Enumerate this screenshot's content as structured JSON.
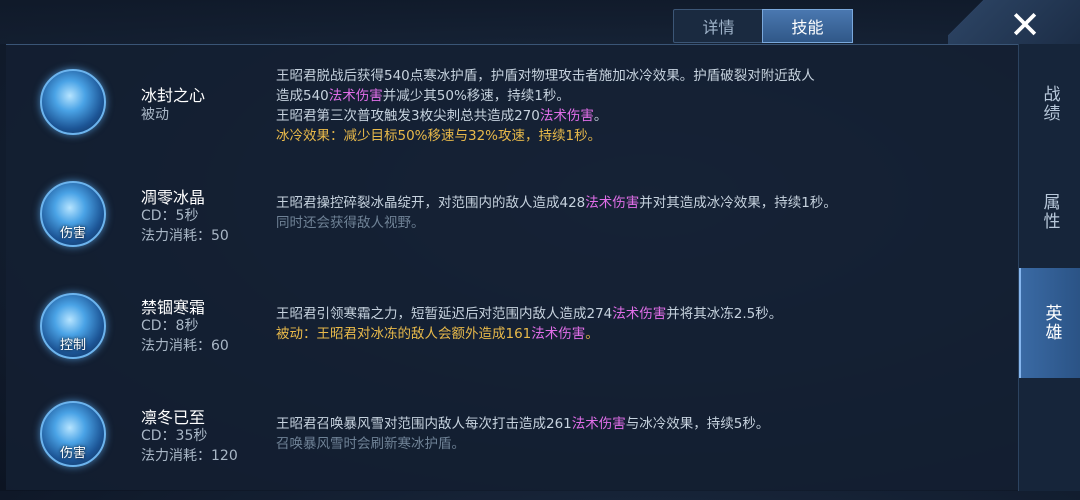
{
  "tabs": {
    "details": "详情",
    "skills": "技能"
  },
  "side_tabs": {
    "record": "战绩",
    "attributes": "属性",
    "hero": "英雄"
  },
  "close_symbol": "✕",
  "skills": [
    {
      "name": "冰封之心",
      "line1": "被动",
      "line2": "",
      "icon_tag": "",
      "desc1a": "王昭君脱战后获得540点寒冰护盾，护盾对物理攻击者施加冰冷效果。护盾破裂对附近敌人",
      "desc2a": "造成540",
      "desc2hl": "法术伤害",
      "desc2b": "并减少其50%移速，持续1秒。",
      "desc3a": "王昭君第三次普攻触发3枚尖刺总共造成270",
      "desc3hl": "法术伤害",
      "desc3b": "。",
      "desc4": "冰冷效果：减少目标50%移速与32%攻速，持续1秒。"
    },
    {
      "name": "凋零冰晶",
      "line1": "CD：5秒",
      "line2": "法力消耗：50",
      "icon_tag": "伤害",
      "desc1a": "王昭君操控碎裂冰晶绽开，对范围内的敌人造成428",
      "desc1hl": "法术伤害",
      "desc1b": "并对其造成冰冷效果，持续1秒。",
      "desc2": "同时还会获得敌人视野。"
    },
    {
      "name": "禁锢寒霜",
      "line1": "CD：8秒",
      "line2": "法力消耗：60",
      "icon_tag": "控制",
      "desc1a": "王昭君引领寒霜之力，短暂延迟后对范围内敌人造成274",
      "desc1hl": "法术伤害",
      "desc1b": "并将其冰冻2.5秒。",
      "desc2a": "被动：王昭君对冰冻的敌人会额外造成161",
      "desc2hl": "法术伤害",
      "desc2b": "。"
    },
    {
      "name": "凛冬已至",
      "line1": "CD：35秒",
      "line2": "法力消耗：120",
      "icon_tag": "伤害",
      "desc1a": "王昭君召唤暴风雪对范围内敌人每次打击造成261",
      "desc1hl": "法术伤害",
      "desc1b": "与冰冷效果，持续5秒。",
      "desc2": "召唤暴风雪时会刷新寒冰护盾。"
    }
  ]
}
